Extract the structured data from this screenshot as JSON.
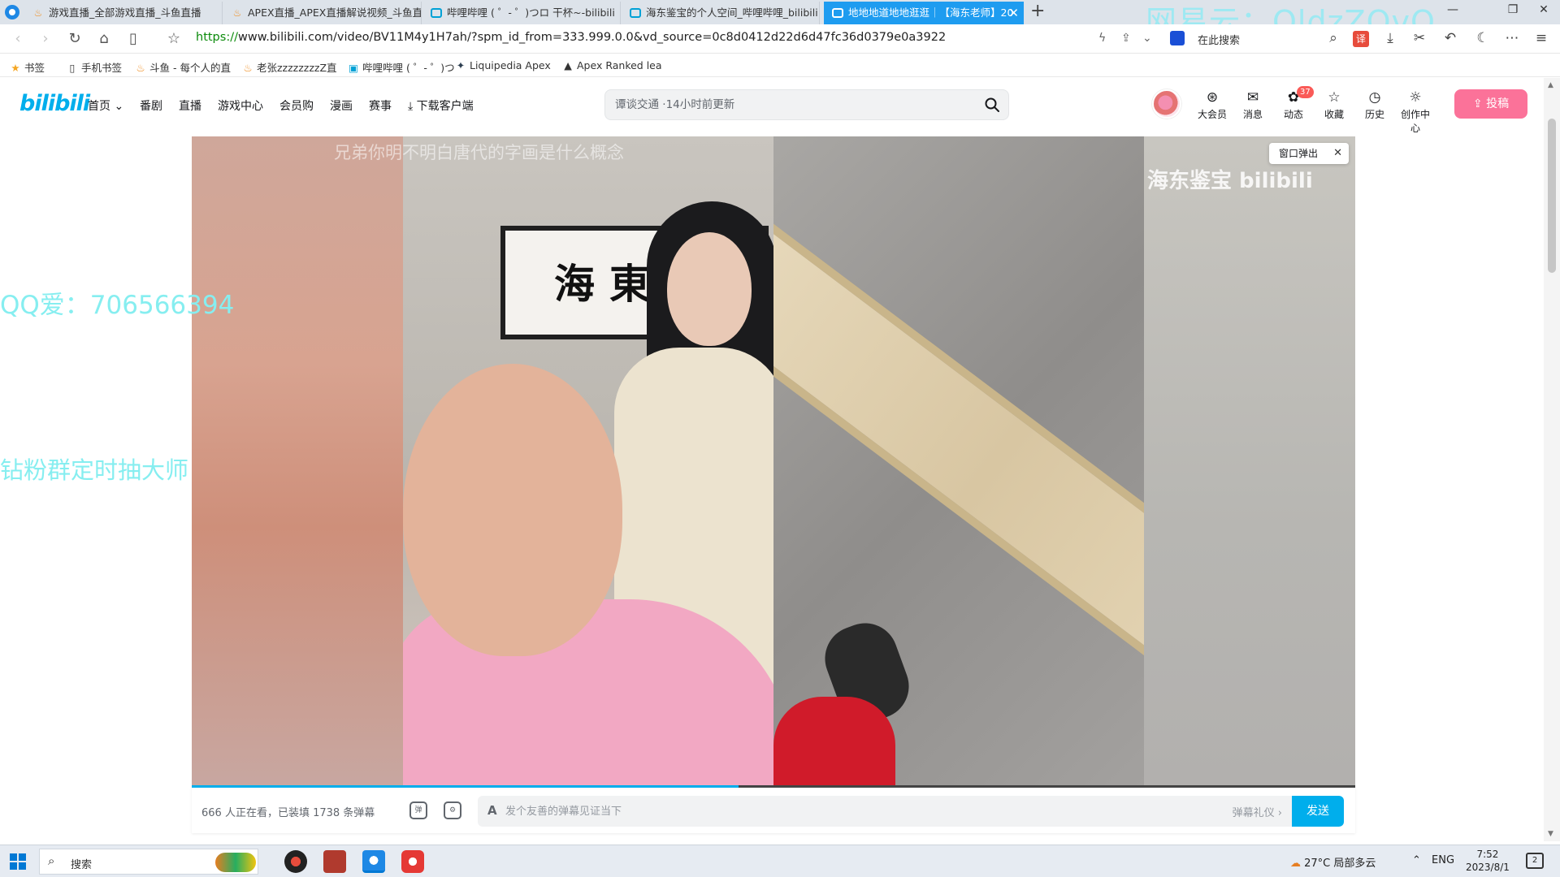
{
  "browser": {
    "tabs": [
      {
        "label": "游戏直播_全部游戏直播_斗鱼直播",
        "icon": "douyu-icon"
      },
      {
        "label": "APEX直播_APEX直播解说视频_斗鱼直",
        "icon": "douyu-icon"
      },
      {
        "label": "哔哩哔哩 ( ゜- ゜)つロ 干杯~-bilibili",
        "icon": "bilibili-tv-icon"
      },
      {
        "label": "海东鉴宝的个人空间_哔哩哔哩_bilibili",
        "icon": "bilibili-tv-icon"
      },
      {
        "label": "地地地道地地逛逛｜【海东老师】20",
        "icon": "bilibili-tv-icon",
        "active": true
      }
    ],
    "overlay_text": "网易云：OldzZOvO",
    "url_scheme": "https://",
    "url_rest": "www.bilibili.com/video/BV11M4y1H7ah/?spm_id_from=333.999.0.0&vd_source=0c8d0412d22d6d47fc36d0379e0a3922",
    "search_hint": "在此搜索",
    "translate_label": "译",
    "bookmarks": [
      {
        "label": "书签",
        "icon": "star-icon"
      },
      {
        "label": "手机书签",
        "icon": "phone-icon"
      },
      {
        "label": "斗鱼 - 每个人的直",
        "icon": "douyu-icon"
      },
      {
        "label": "老张zzzzzzzzZ直",
        "icon": "douyu-icon"
      },
      {
        "label": "哔哩哔哩 ( ゜- ゜)つ",
        "icon": "bilibili-tv-icon"
      },
      {
        "label": "Liquipedia Apex",
        "icon": "liquipedia-icon"
      },
      {
        "label": "Apex Ranked lea",
        "icon": "apex-icon"
      }
    ]
  },
  "bili": {
    "logo": "bilibili",
    "nav": [
      "首页",
      "番剧",
      "直播",
      "游戏中心",
      "会员购",
      "漫画",
      "赛事",
      "下载客户端"
    ],
    "search_placeholder": "谭谈交通 ·14小时前更新",
    "header_items": [
      {
        "label": "大会员",
        "icon": "vip-icon"
      },
      {
        "label": "消息",
        "icon": "message-icon"
      },
      {
        "label": "动态",
        "icon": "dynamic-icon",
        "badge": "37"
      },
      {
        "label": "收藏",
        "icon": "star-icon"
      },
      {
        "label": "历史",
        "icon": "clock-icon"
      },
      {
        "label": "创作中心",
        "icon": "lightbulb-icon"
      }
    ],
    "upload_label": "投稿"
  },
  "player": {
    "danmaku_scrolling": "兄弟你明不明白唐代的字画是什么概念",
    "channel_watermark": "海东鉴宝 bilibili",
    "calligraphy": "海東",
    "popout_label": "窗口弹出",
    "progress": 0.47,
    "viewer_info": "666 人正在看，已装填 1738 条弹幕",
    "danmaku_placeholder": "发个友善的弹幕见证当下",
    "danmaku_etiquette": "弹幕礼仪 ›",
    "send_label": "发送"
  },
  "overlays": {
    "qq": "QQ爱：706566394",
    "fans": "钻粉群定时抽大师"
  },
  "taskbar": {
    "search_label": "搜索",
    "weather": "27°C 局部多云",
    "lang": "ENG",
    "time": "7:52",
    "date": "2023/8/1",
    "notifications": "2"
  },
  "colors": {
    "bili_blue": "#00aeec",
    "bili_pink": "#fb7299",
    "tab_active": "#1e9cf0"
  }
}
